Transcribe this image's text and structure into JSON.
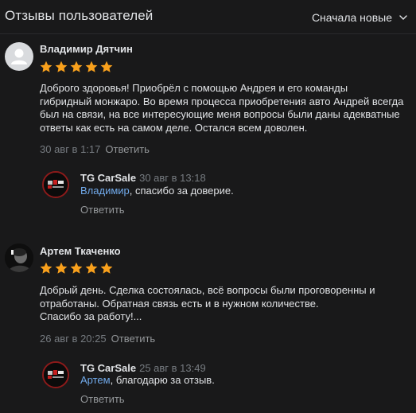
{
  "header": {
    "title": "Отзывы пользователей",
    "sort_label": "Сначала новые"
  },
  "reviews": [
    {
      "author": "Владимир Дятчин",
      "rating": 5,
      "lines": [
        "Доброго здоровья! Приобрёл с помощью Андрея и его команды",
        "гибридный монжаро. Во время процесса приобретения авто Андрей всегда",
        "был на связи, на все интересующие меня вопросы были даны адекватные",
        "ответы как есть на самом деле. Остался всем доволен."
      ],
      "date": "30 авг в 1:17",
      "reply_label": "Ответить",
      "reply": {
        "author": "TG CarSale",
        "date": "30 авг в 13:18",
        "mention": "Владимир",
        "text": ", спасибо за доверие.",
        "reply_label": "Ответить"
      }
    },
    {
      "author": "Артем Ткаченко",
      "rating": 5,
      "lines": [
        "Добрый день. Сделка состоялась, всё вопросы были проговоренны и",
        "отработаны. Обратная связь есть и в нужном количестве.",
        "Спасибо за работу!..."
      ],
      "date": "26 авг в 20:25",
      "reply_label": "Ответить",
      "reply": {
        "author": "TG CarSale",
        "date": "25 авг в 13:49",
        "mention": "Артем",
        "text": ", благодарю за отзыв.",
        "reply_label": "Ответить"
      }
    }
  ],
  "colors": {
    "background": "#19191a",
    "star": "#f8a01c",
    "mention": "#71aaeb",
    "muted": "#767b80"
  }
}
